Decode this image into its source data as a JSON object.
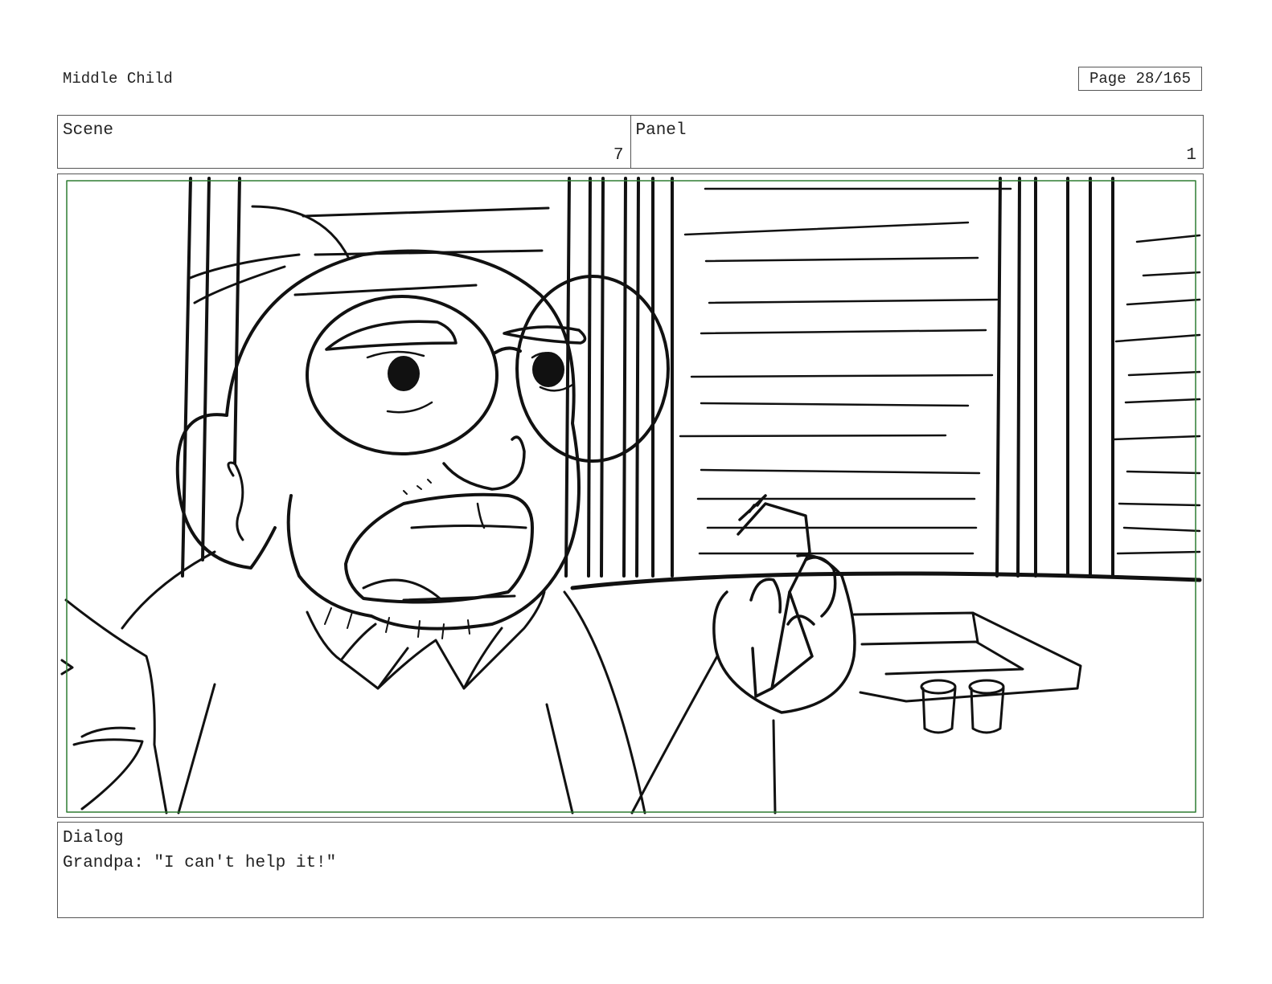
{
  "document": {
    "title": "Middle Child",
    "page_label": "Page",
    "page_number": "28/165"
  },
  "info": {
    "scene_label": "Scene",
    "scene_value": "7",
    "panel_label": "Panel",
    "panel_value": "1"
  },
  "panel_image": {
    "safe_area_color": "#2e7d32",
    "line_color": "#111111"
  },
  "dialog": {
    "label": "Dialog",
    "text": "Grandpa: \"I can't help it!\""
  }
}
